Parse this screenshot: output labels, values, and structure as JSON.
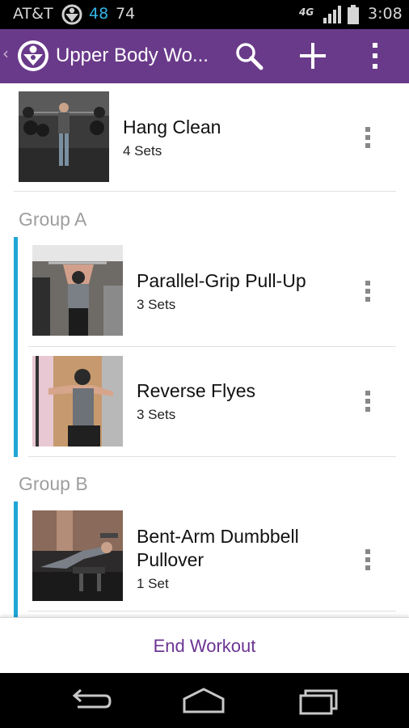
{
  "status_bar": {
    "carrier": "AT&T",
    "temp_blue": "48",
    "temp_gray": "74",
    "network": "4G",
    "time": "3:08"
  },
  "action_bar": {
    "title": "Upper Body Wo...",
    "icons": [
      "back-chevron-icon",
      "app-logo-icon",
      "search-icon",
      "plus-icon",
      "overflow-menu-icon"
    ]
  },
  "workout": {
    "top_exercise": {
      "name": "Hang Clean",
      "sets": "4 Sets"
    },
    "groups": [
      {
        "label": "Group A",
        "exercises": [
          {
            "name": "Parallel-Grip Pull-Up",
            "sets": "3 Sets"
          },
          {
            "name": "Reverse Flyes",
            "sets": "3 Sets"
          }
        ]
      },
      {
        "label": "Group B",
        "exercises": [
          {
            "name_line1": "Bent-Arm Dumbbell",
            "name_line2": "Pullover",
            "sets": "1 Set"
          }
        ]
      }
    ]
  },
  "footer": {
    "end_label": "End Workout"
  },
  "colors": {
    "action_bar": "#6a3a8a",
    "group_accent": "#1fa6d6",
    "end_text": "#6b3493"
  }
}
